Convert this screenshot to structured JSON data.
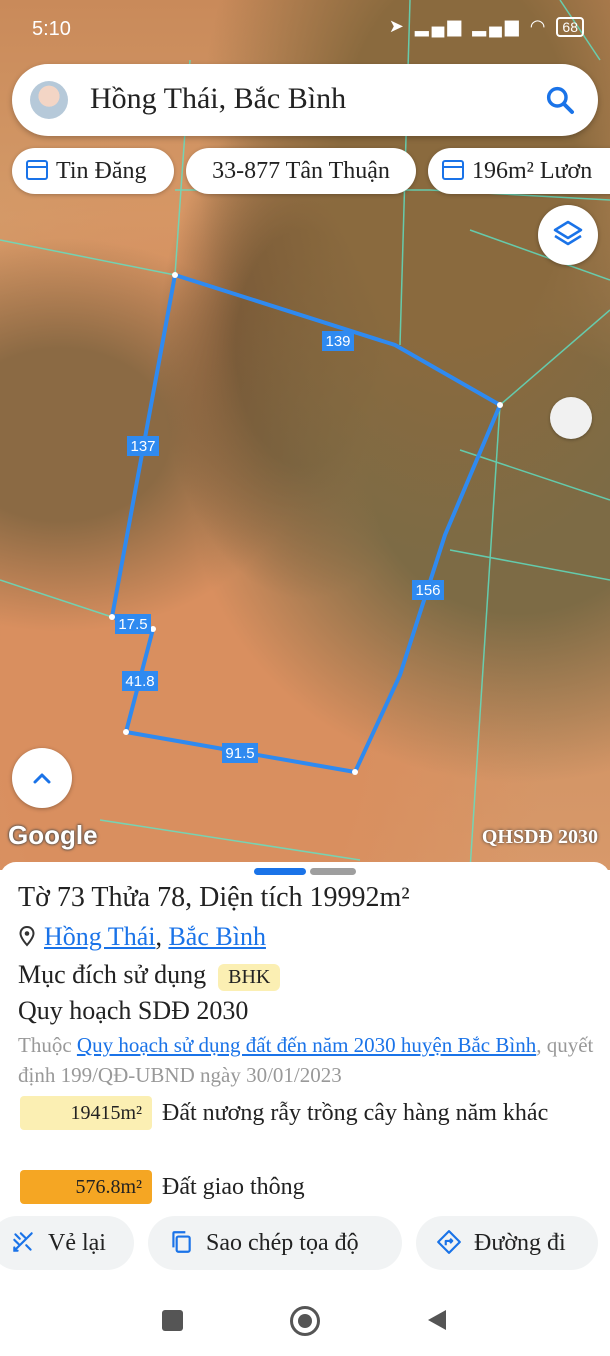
{
  "status_bar": {
    "time": "5:10",
    "battery": "68",
    "icons": "➤ ▂▄▆ ▂▄▆ ◠"
  },
  "search": {
    "title": "Hồng Thái, Bắc Bình"
  },
  "chips": [
    {
      "label": "Tin Đăng"
    },
    {
      "label": "33-877 Tân Thuận"
    },
    {
      "label": "196m² Lươn"
    }
  ],
  "map": {
    "edge_labels": [
      "139",
      "137",
      "156",
      "17.5",
      "41.8",
      "91.5"
    ],
    "google_logo": "Google",
    "overlay_label": "QHSDĐ 2030",
    "colors": {
      "parcel_outline": "#2f8af0",
      "label_bg": "#2f8af0"
    }
  },
  "parcel": {
    "heading": "Tờ 73 Thửa 78, Diện tích 19992m²",
    "location_1": "Hồng Thái",
    "location_sep": ", ",
    "location_2": "Bắc Bình",
    "purpose_label": "Mục đích sử dụng",
    "purpose_badge": "BHK",
    "planning_title": "Quy hoạch SDĐ 2030",
    "belong_prefix": "Thuộc ",
    "belong_link": "Quy hoạch sử dụng đất đến năm 2030 huyện Bắc Bình",
    "belong_suffix": ", quyết định 199/QĐ-UBND ngày 30/01/2023",
    "rows": [
      {
        "area": "19415m²",
        "desc": "Đất nương rẫy trồng cây hàng năm khác",
        "color": "#fbefb3"
      },
      {
        "area": "576.8m²",
        "desc": "Đất giao thông",
        "color": "#f5a623"
      }
    ]
  },
  "actions": {
    "redraw": "Vẻ lại",
    "copy_coords": "Sao chép tọa độ",
    "directions": "Đường đi"
  }
}
